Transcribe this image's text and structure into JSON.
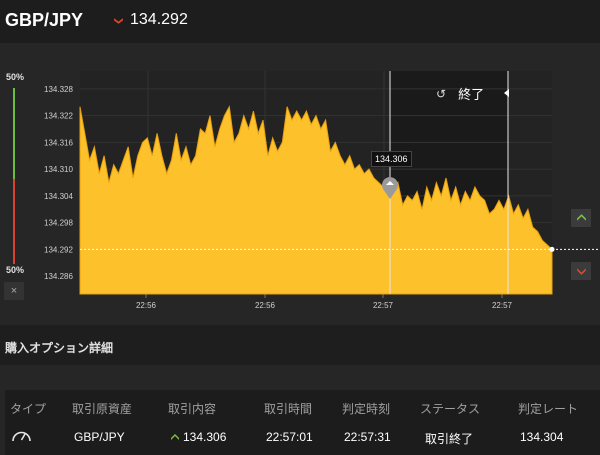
{
  "header": {
    "pair": "GBP/JPY",
    "rate": "134.292",
    "direction_icon": "triangle-down-icon",
    "down_color": "#e0462f"
  },
  "gauge": {
    "top_label": "50%",
    "bottom_label": "50%",
    "close_label": "×",
    "up_color": "#6cbf3a",
    "down_color": "#d9432b"
  },
  "chart_data": {
    "type": "area",
    "title": "",
    "xlabel": "",
    "ylabel": "",
    "ylim": [
      134.282,
      134.332
    ],
    "yticks": [
      "134.328",
      "134.322",
      "134.316",
      "134.310",
      "134.304",
      "134.298",
      "134.292",
      "134.286"
    ],
    "xticks": [
      "22:56",
      "22:56",
      "22:57",
      "22:57"
    ],
    "fill_color": "#fcc12b",
    "current_rate": 134.292,
    "entry_rate": 134.306,
    "entry_label": "134.306",
    "series": [
      {
        "values": [
          134.324,
          134.318,
          134.312,
          134.315,
          134.309,
          134.313,
          134.307,
          134.311,
          134.309,
          134.312,
          134.315,
          134.308,
          134.313,
          134.316,
          134.317,
          134.313,
          134.318,
          134.313,
          134.309,
          134.312,
          134.318,
          134.312,
          134.315,
          134.311,
          134.313,
          134.319,
          134.318,
          134.322,
          134.315,
          134.319,
          134.322,
          134.324,
          134.316,
          134.318,
          134.322,
          134.319,
          134.323,
          134.318,
          134.321,
          134.313,
          134.317,
          134.314,
          134.316,
          134.324,
          134.321,
          134.323,
          134.321,
          134.323,
          134.32,
          134.322,
          134.319,
          134.321,
          134.314,
          134.316,
          134.313,
          134.311,
          134.313,
          134.31,
          134.311,
          134.309,
          134.31,
          134.308,
          134.307,
          134.306,
          134.308,
          134.305,
          134.307,
          134.302,
          134.304,
          134.303,
          134.305,
          134.301,
          134.306,
          134.303,
          134.307,
          134.304,
          134.308,
          134.303,
          134.306,
          134.302,
          134.305,
          134.303,
          134.306,
          134.304,
          134.303,
          134.3,
          134.301,
          134.303,
          134.301,
          134.304,
          134.3,
          134.302,
          134.299,
          134.301,
          134.297,
          134.296,
          134.294,
          134.293,
          134.292
        ]
      }
    ]
  },
  "chart_labels": {
    "end_label": "終了",
    "clock_icon": "history-clock-icon"
  },
  "controls": {
    "up_icon": "chevron-up-icon",
    "down_icon": "chevron-down-icon",
    "up_color": "#7bc043",
    "down_color": "#d94a35"
  },
  "details": {
    "title": "購入オプション詳細",
    "headers": [
      "タイプ",
      "取引原資産",
      "取引内容",
      "取引時間",
      "判定時刻",
      "ステータス",
      "判定レート"
    ],
    "row": {
      "type_icon": "gauge-icon",
      "asset": "GBP/JPY",
      "direction_icon": "chevron-up-icon",
      "content": "134.306",
      "trade_time": "22:57:01",
      "judge_time": "22:57:31",
      "status": "取引終了",
      "judge_rate": "134.304"
    }
  }
}
